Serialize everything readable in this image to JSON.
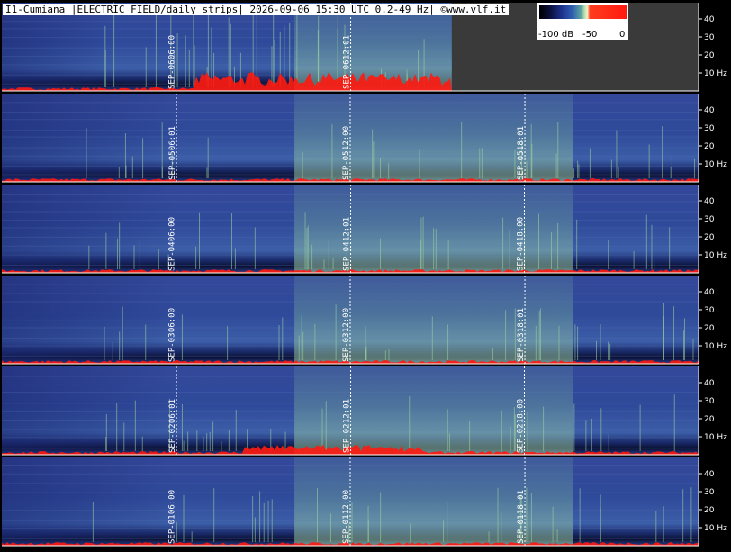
{
  "header": {
    "title": "I1-Cumiana |ELECTRIC FIELD/daily strips| 2026-09-06 15:30 UTC 0.2-49 Hz| ©www.vlf.it"
  },
  "legend": {
    "labels": [
      "-100 dB",
      "-50",
      "0"
    ],
    "colors": [
      "#000000",
      "#1c2f8a",
      "#5fa7a0",
      "#f2f2c8",
      "#ff1a10"
    ]
  },
  "axis": {
    "y_ticks": [
      "40",
      "30",
      "20",
      "10 Hz"
    ],
    "y_values": [
      40,
      30,
      20,
      10
    ],
    "ylim": [
      0,
      49
    ],
    "unit": "Hz"
  },
  "colors": {
    "background": "#000000",
    "spectrogram_base": "#2a3f8f",
    "activity": "#9fd6a0",
    "burst": "#ff1a10",
    "empty_area": "#3a3a3a"
  },
  "chart_data": [
    {
      "type": "heatmap",
      "strip": 1,
      "markers": [
        {
          "date": "SEP-06",
          "time": "06:00"
        },
        {
          "date": "SEP-06",
          "time": "12:01"
        }
      ],
      "recorded_until": "15:30"
    },
    {
      "type": "heatmap",
      "strip": 2,
      "markers": [
        {
          "date": "SEP-05",
          "time": "06:01"
        },
        {
          "date": "SEP-05",
          "time": "12:00"
        },
        {
          "date": "SEP-05",
          "time": "18:01"
        }
      ]
    },
    {
      "type": "heatmap",
      "strip": 3,
      "markers": [
        {
          "date": "SEP-04",
          "time": "06:00"
        },
        {
          "date": "SEP-04",
          "time": "12:01"
        },
        {
          "date": "SEP-04",
          "time": "18:00"
        }
      ]
    },
    {
      "type": "heatmap",
      "strip": 4,
      "markers": [
        {
          "date": "SEP-03",
          "time": "06:00"
        },
        {
          "date": "SEP-03",
          "time": "12:00"
        },
        {
          "date": "SEP-03",
          "time": "18:01"
        }
      ]
    },
    {
      "type": "heatmap",
      "strip": 5,
      "markers": [
        {
          "date": "SEP-02",
          "time": "06:01"
        },
        {
          "date": "SEP-02",
          "time": "12:01"
        },
        {
          "date": "SEP-02",
          "time": "18:00"
        }
      ]
    },
    {
      "type": "heatmap",
      "strip": 6,
      "markers": [
        {
          "date": "SEP-01",
          "time": "06:00"
        },
        {
          "date": "SEP-01",
          "time": "12:00"
        },
        {
          "date": "SEP-01",
          "time": "18:01"
        }
      ]
    }
  ]
}
